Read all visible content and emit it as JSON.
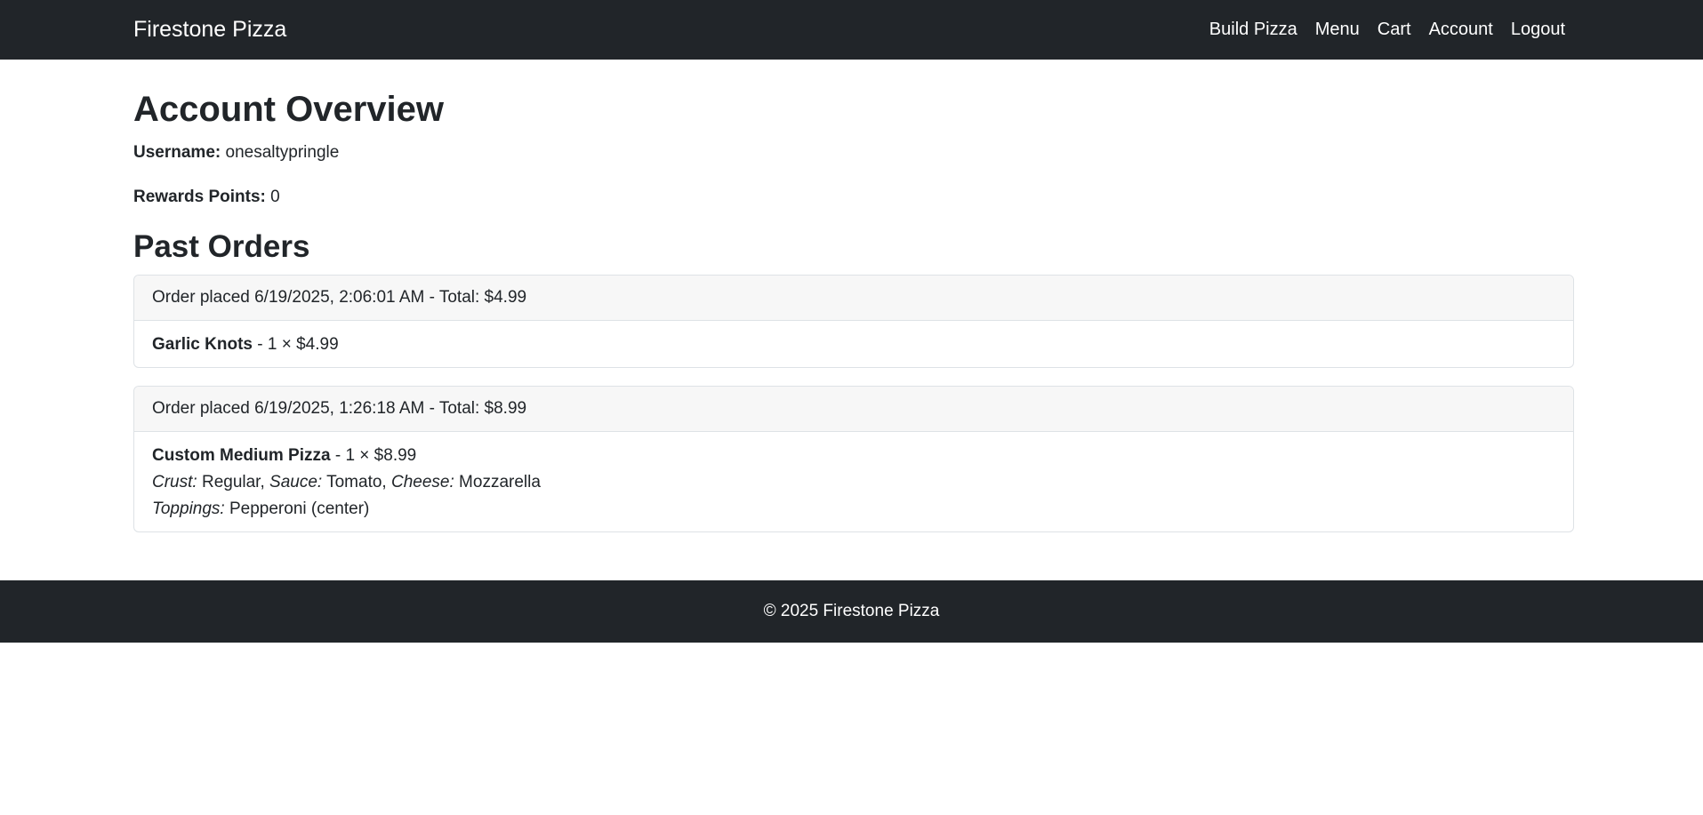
{
  "navbar": {
    "brand": "Firestone Pizza",
    "links": [
      {
        "label": "Build Pizza"
      },
      {
        "label": "Menu"
      },
      {
        "label": "Cart"
      },
      {
        "label": "Account"
      },
      {
        "label": "Logout"
      }
    ],
    "bg_color": "#212529"
  },
  "account": {
    "title": "Account Overview",
    "username_label": "Username:",
    "username": "onesaltypringle",
    "rewards_label": "Rewards Points:",
    "rewards": "0"
  },
  "orders": {
    "title": "Past Orders",
    "list": [
      {
        "header": "Order placed 6/19/2025, 2:06:01 AM - Total: $4.99",
        "item_name": "Garlic Knots",
        "item_qty": " - 1 × $4.99"
      },
      {
        "header": "Order placed 6/19/2025, 1:26:18 AM - Total: $8.99",
        "item_name": "Custom Medium Pizza",
        "item_qty": " - 1 × $8.99",
        "crust_label": "Crust:",
        "crust": " Regular, ",
        "sauce_label": "Sauce:",
        "sauce": " Tomato, ",
        "cheese_label": "Cheese:",
        "cheese": " Mozzarella",
        "toppings_label": "Toppings:",
        "toppings": " Pepperoni (center)"
      }
    ]
  },
  "footer": {
    "text": "© 2025 Firestone Pizza"
  }
}
